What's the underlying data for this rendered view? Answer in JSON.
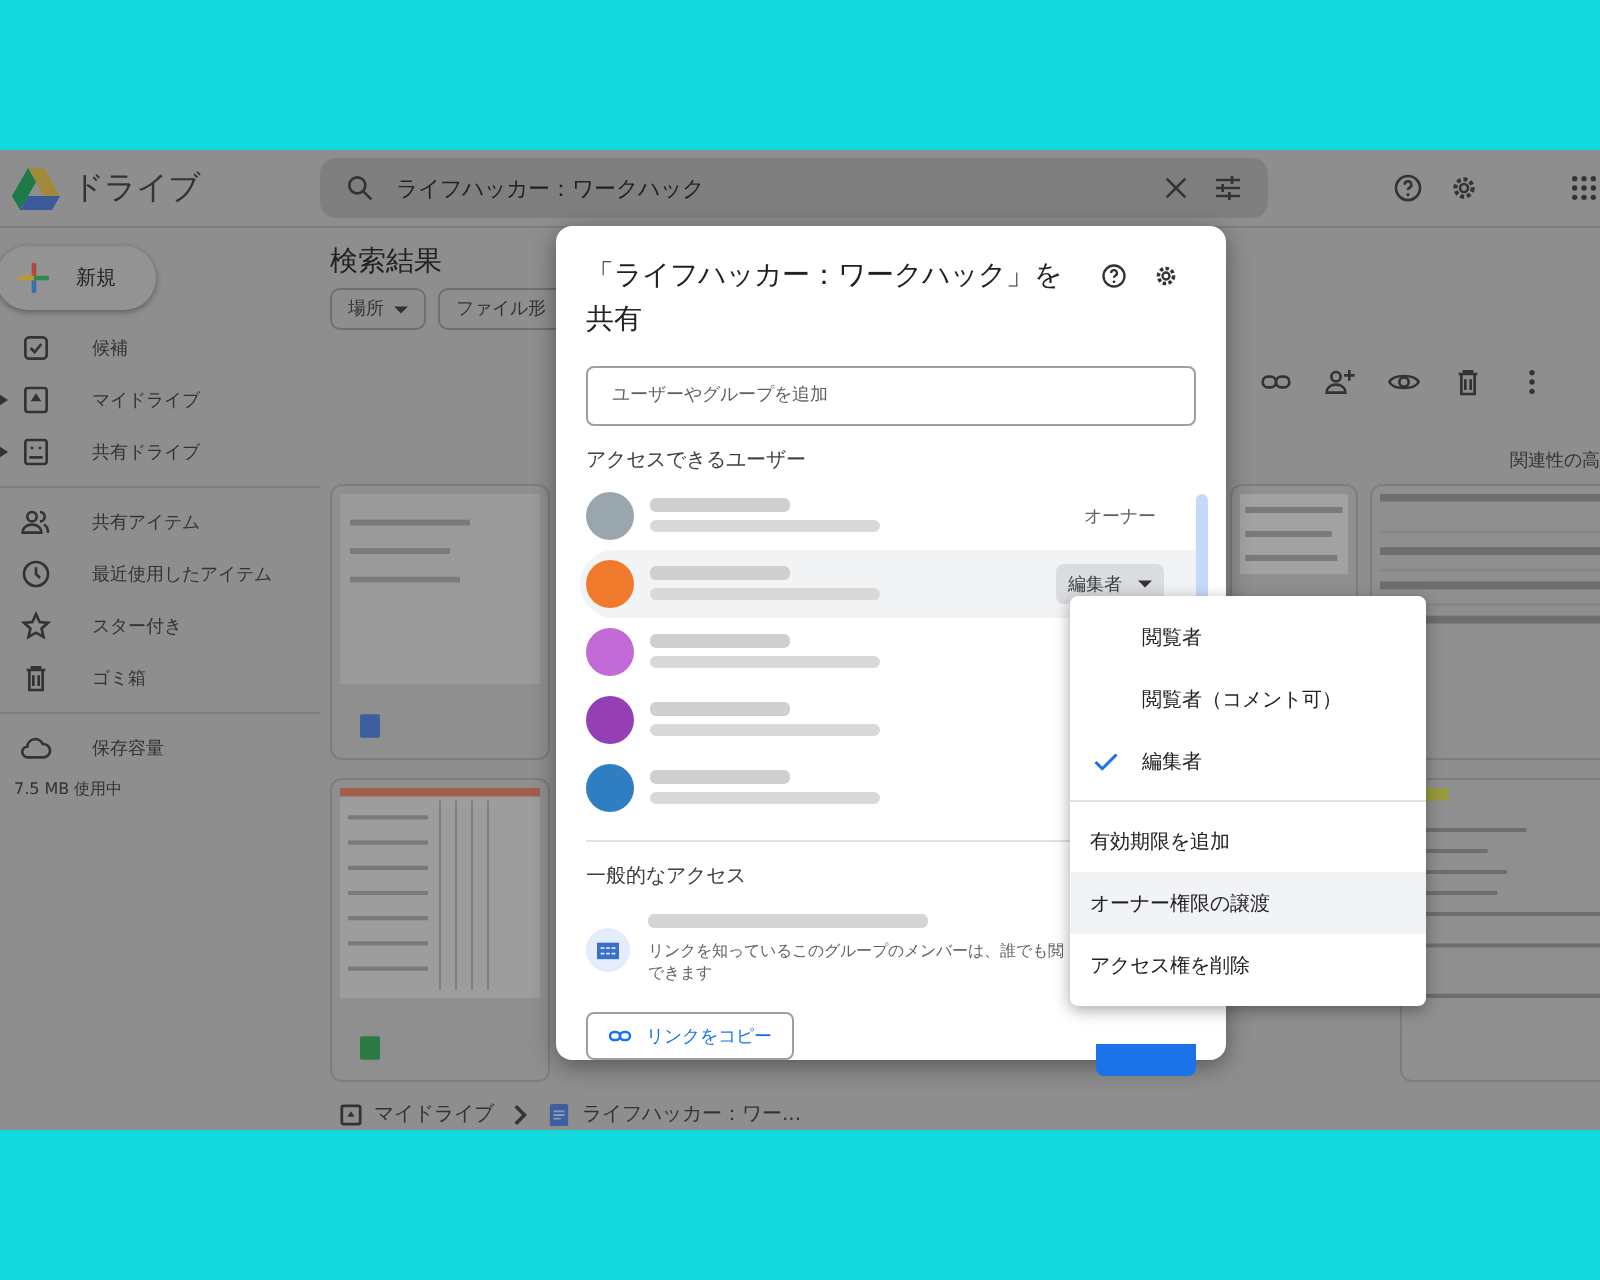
{
  "app": {
    "name": "ドライブ"
  },
  "search": {
    "value": "ライフハッカー：ワークハック"
  },
  "sidebar": {
    "new_button": "新規",
    "items": [
      {
        "label": "候補",
        "kind": "nav"
      },
      {
        "label": "マイドライブ",
        "kind": "folder"
      },
      {
        "label": "共有ドライブ",
        "kind": "folder"
      },
      {
        "label": "共有アイテム",
        "kind": "nav"
      },
      {
        "label": "最近使用したアイテム",
        "kind": "nav"
      },
      {
        "label": "スター付き",
        "kind": "nav"
      },
      {
        "label": "ゴミ箱",
        "kind": "nav"
      },
      {
        "label": "保存容量",
        "kind": "nav"
      }
    ],
    "storage_usage": "7.5 MB 使用中"
  },
  "main": {
    "heading": "検索結果",
    "filters": [
      {
        "label": "場所",
        "dropdown": true
      },
      {
        "label": "ファイル形",
        "dropdown": false
      }
    ],
    "sort_label": "関連性の高"
  },
  "breadcrumb": [
    {
      "label": "マイドライブ",
      "kind": "folder"
    },
    {
      "label": "ライフハッカー：ワー...",
      "kind": "doc"
    }
  ],
  "dialog": {
    "title": "「ライフハッカー：ワークハック」を共有",
    "placeholder": "ユーザーやグループを追加",
    "people_heading": "アクセスできるユーザー",
    "people": [
      {
        "color": "#9aa6ae",
        "highlighted": false,
        "role": "オーナー",
        "role_dropdown": false
      },
      {
        "color": "#ef7a2c",
        "highlighted": true,
        "role": "編集者",
        "role_dropdown": true
      },
      {
        "color": "#c26ad8",
        "highlighted": false
      },
      {
        "color": "#9440b4",
        "highlighted": false
      },
      {
        "color": "#2f7ec2",
        "highlighted": false
      }
    ],
    "general_heading": "一般的なアクセス",
    "general_description": [
      "リンクを知っているこのグループのメンバーは、誰でも閲",
      "できます"
    ],
    "copy_link": "リンクをコピー"
  },
  "menu": {
    "items": [
      {
        "label": "閲覧者",
        "kind": "role",
        "selected": false,
        "highlighted": false
      },
      {
        "label": "閲覧者（コメント可）",
        "kind": "role",
        "selected": false,
        "highlighted": false
      },
      {
        "label": "編集者",
        "kind": "role",
        "selected": true,
        "highlighted": false
      },
      {
        "label": "有効期限を追加",
        "kind": "action",
        "highlighted": false
      },
      {
        "label": "オーナー権限の譲渡",
        "kind": "action",
        "highlighted": true
      },
      {
        "label": "アクセス権を削除",
        "kind": "action",
        "highlighted": false
      }
    ]
  }
}
